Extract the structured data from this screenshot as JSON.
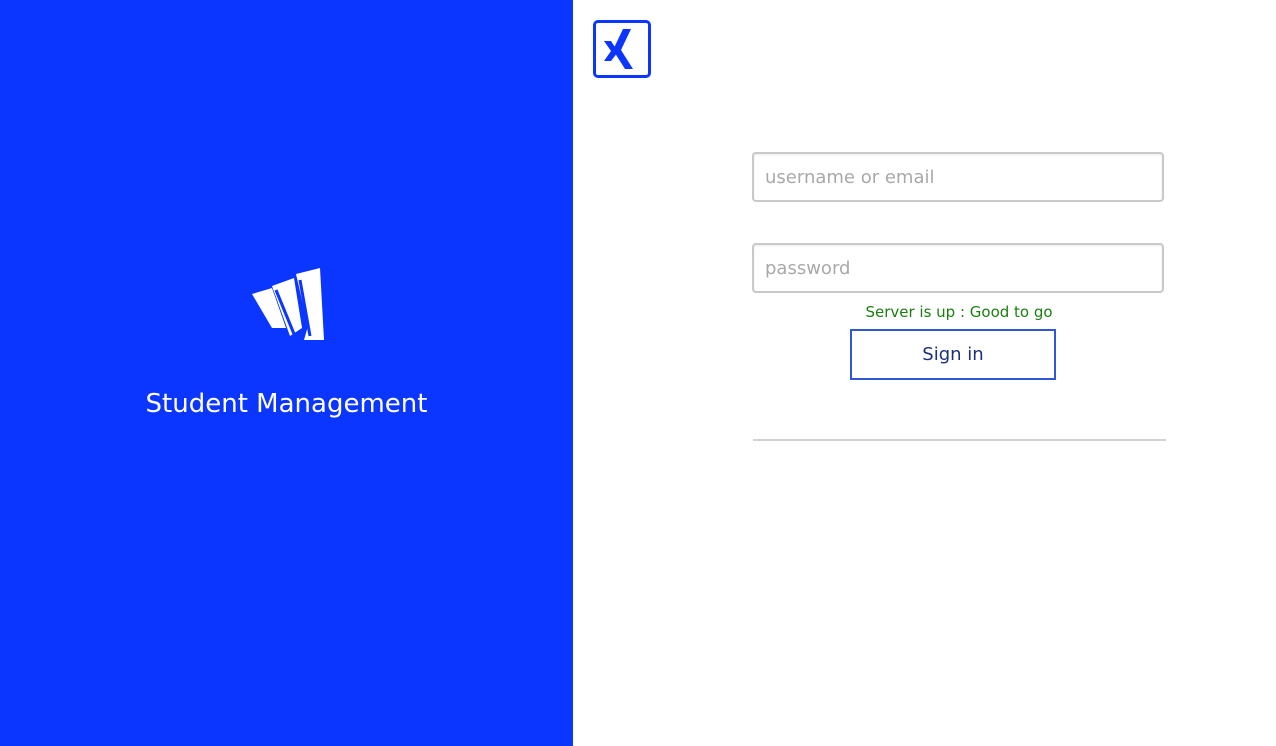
{
  "brand": {
    "name": "Student Management",
    "logo_icon": "stacked-bars-logo-icon",
    "panel_color": "#0a36ff"
  },
  "corner_logo": {
    "icon": "x-logo-icon",
    "color": "#0a36ff"
  },
  "login_form": {
    "username_placeholder": "username or email",
    "username_value": "",
    "password_placeholder": "password",
    "password_value": "",
    "status_text": "Server is up : Good to go",
    "status_color": "#1a7f0f",
    "signin_label": "Sign in"
  }
}
